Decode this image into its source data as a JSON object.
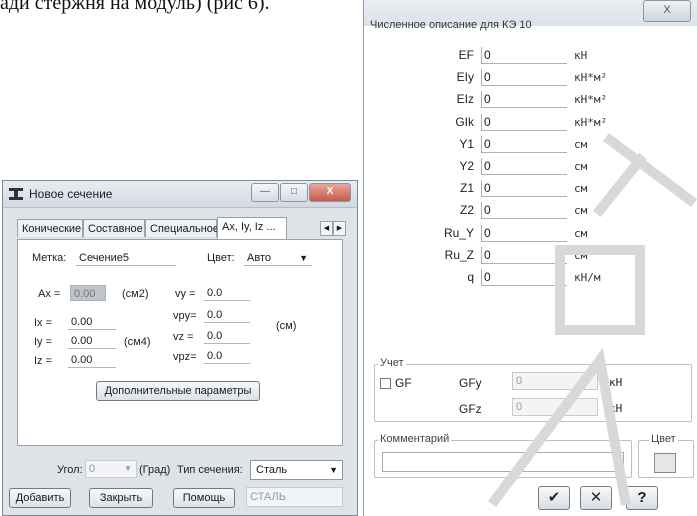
{
  "background_doc": {
    "text": "ади стержня на модуль) (рис 6)."
  },
  "new_section_dialog": {
    "title": "Новое сечение",
    "window_buttons": {
      "minimize": "—",
      "maximize": "□",
      "close": "X"
    },
    "tabs": [
      "Конические",
      "Составное",
      "Специальное",
      "Ax, Iy, Iz ..."
    ],
    "mark_label": "Метка:",
    "mark_value": "Сечение5",
    "color_label": "Цвет:",
    "color_value": "Авто",
    "ax_label": "Ax =",
    "ax_value": "0.00",
    "cm2_unit": "(см2)",
    "ix_label": "Ix =",
    "ix_value": "0.00",
    "iy_label": "Iy =",
    "iy_value": "0.00",
    "iz_label": "Iz =",
    "iz_value": "0.00",
    "cm4_unit": "(см4)",
    "vy_label": "vy =",
    "vy_value": "0.0",
    "vpy_label": "vpy=",
    "vpy_value": "0.0",
    "vz_label": "vz =",
    "vz_value": "0.0",
    "vpz_label": "vpz=",
    "vpz_value": "0.0",
    "cm_unit": "(см)",
    "extra_params_button": "Дополнительные параметры",
    "angle_label": "Угол:",
    "angle_value": "0",
    "degree_unit": "(Град)",
    "section_type_label": "Тип сечения:",
    "section_type_value": "Сталь",
    "add_button": "Добавить",
    "close_button": "Закрыть",
    "help_button": "Помощь",
    "material_value": "СТАЛЬ"
  },
  "numeric_dialog": {
    "title": "Численное описание для КЭ 10",
    "close_button": "X",
    "rows": [
      {
        "label": "EF",
        "value": "0",
        "unit": "кН"
      },
      {
        "label": "EIy",
        "value": "0",
        "unit": "кН*м²"
      },
      {
        "label": "EIz",
        "value": "0",
        "unit": "кН*м²"
      },
      {
        "label": "GIk",
        "value": "0",
        "unit": "кН*м²"
      },
      {
        "label": "Y1",
        "value": "0",
        "unit": "см"
      },
      {
        "label": "Y2",
        "value": "0",
        "unit": "см"
      },
      {
        "label": "Z1",
        "value": "0",
        "unit": "см"
      },
      {
        "label": "Z2",
        "value": "0",
        "unit": "см"
      },
      {
        "label": "Ru_Y",
        "value": "0",
        "unit": "см"
      },
      {
        "label": "Ru_Z",
        "value": "0",
        "unit": "см"
      },
      {
        "label": "q",
        "value": "0",
        "unit": "кН/м"
      }
    ],
    "account_group_title": "Учет",
    "gf_label": "GF",
    "gfy_label": "GFy",
    "gfy_value": "0",
    "gfy_unit": "кН",
    "gfz_label": "GFz",
    "gfz_value": "0",
    "gfz_unit": "кН",
    "comment_label": "Комментарий",
    "color_label": "Цвет",
    "ok_glyph": "✔",
    "cancel_glyph": "✕",
    "help_glyph": "?"
  },
  "colors": {
    "watermark": "#d8d8d8",
    "dialog_bg": "#dfe3e8",
    "gray_field": "#bfc4c9"
  }
}
